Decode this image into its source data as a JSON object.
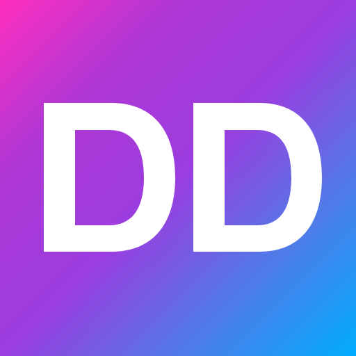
{
  "logo": {
    "text": "DD",
    "text_color": "#ffffff",
    "gradient": [
      "#ff2ebf",
      "#b037d6",
      "#9b3ddf",
      "#4f7be8",
      "#00adff"
    ]
  }
}
